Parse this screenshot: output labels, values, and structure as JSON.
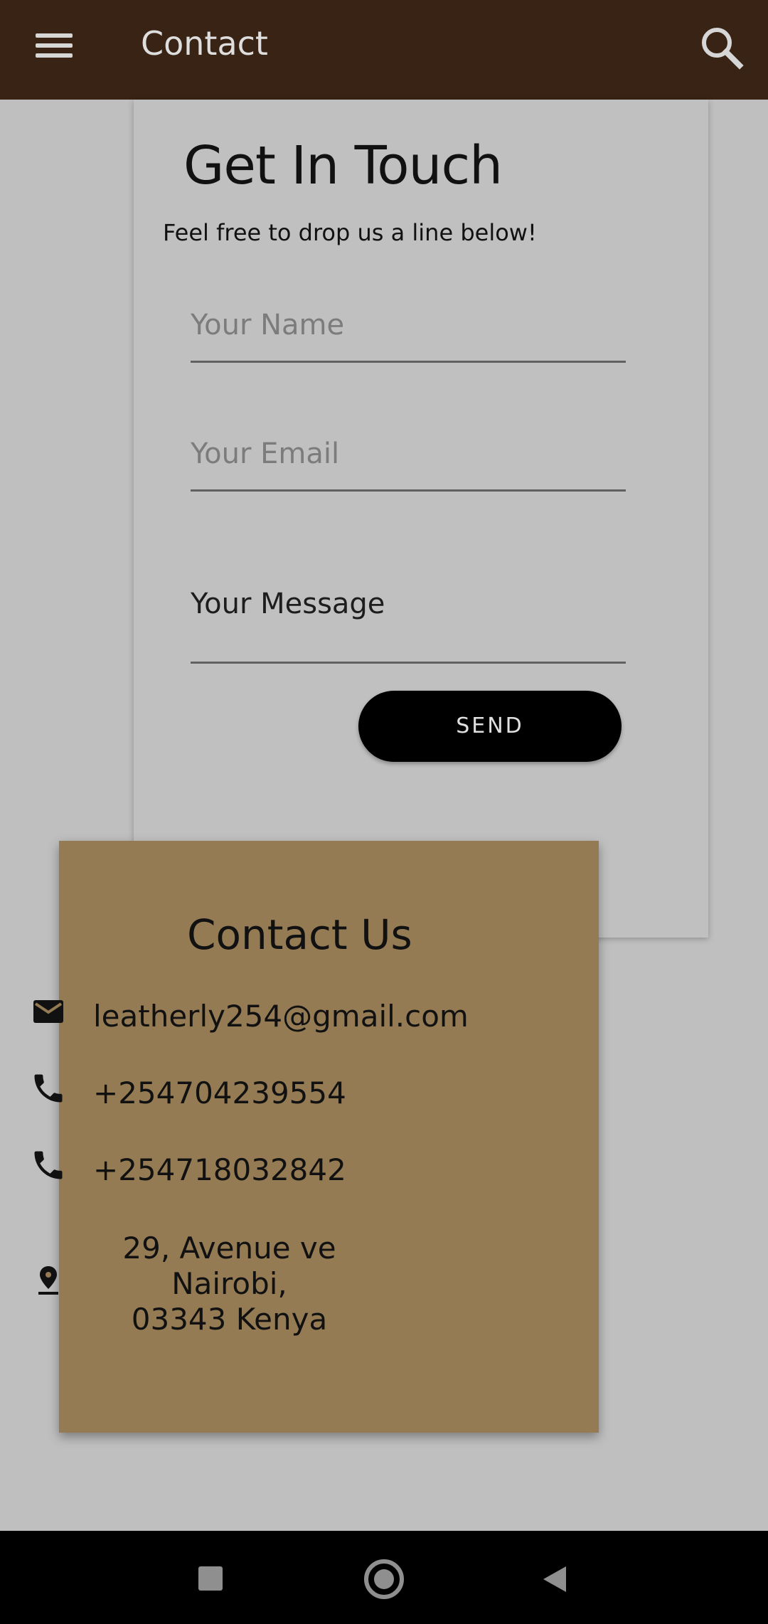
{
  "app_bar": {
    "title": "Contact",
    "menu_icon": "hamburger-menu-icon",
    "search_icon": "search-icon"
  },
  "form": {
    "title": "Get In Touch",
    "subtitle": "Feel free to drop us a line below!",
    "name_placeholder": "Your Name",
    "email_placeholder": "Your Email",
    "message_placeholder": "Your Message",
    "send_label": "SEND"
  },
  "contact": {
    "title": "Contact Us",
    "email": "leatherly254@gmail.com",
    "phone1": "+254704239554",
    "phone2": "+254718032842",
    "address_line1": "29, Avenue ve Nairobi,",
    "address_line2": "03343 Kenya"
  },
  "colors": {
    "app_bar": "#382314",
    "background": "#bfbfbf",
    "contact_card": "#957b54",
    "send_button": "#000000"
  },
  "nav_bar": {
    "recent_icon": "recent-apps-icon",
    "home_icon": "home-icon",
    "back_icon": "back-icon"
  }
}
